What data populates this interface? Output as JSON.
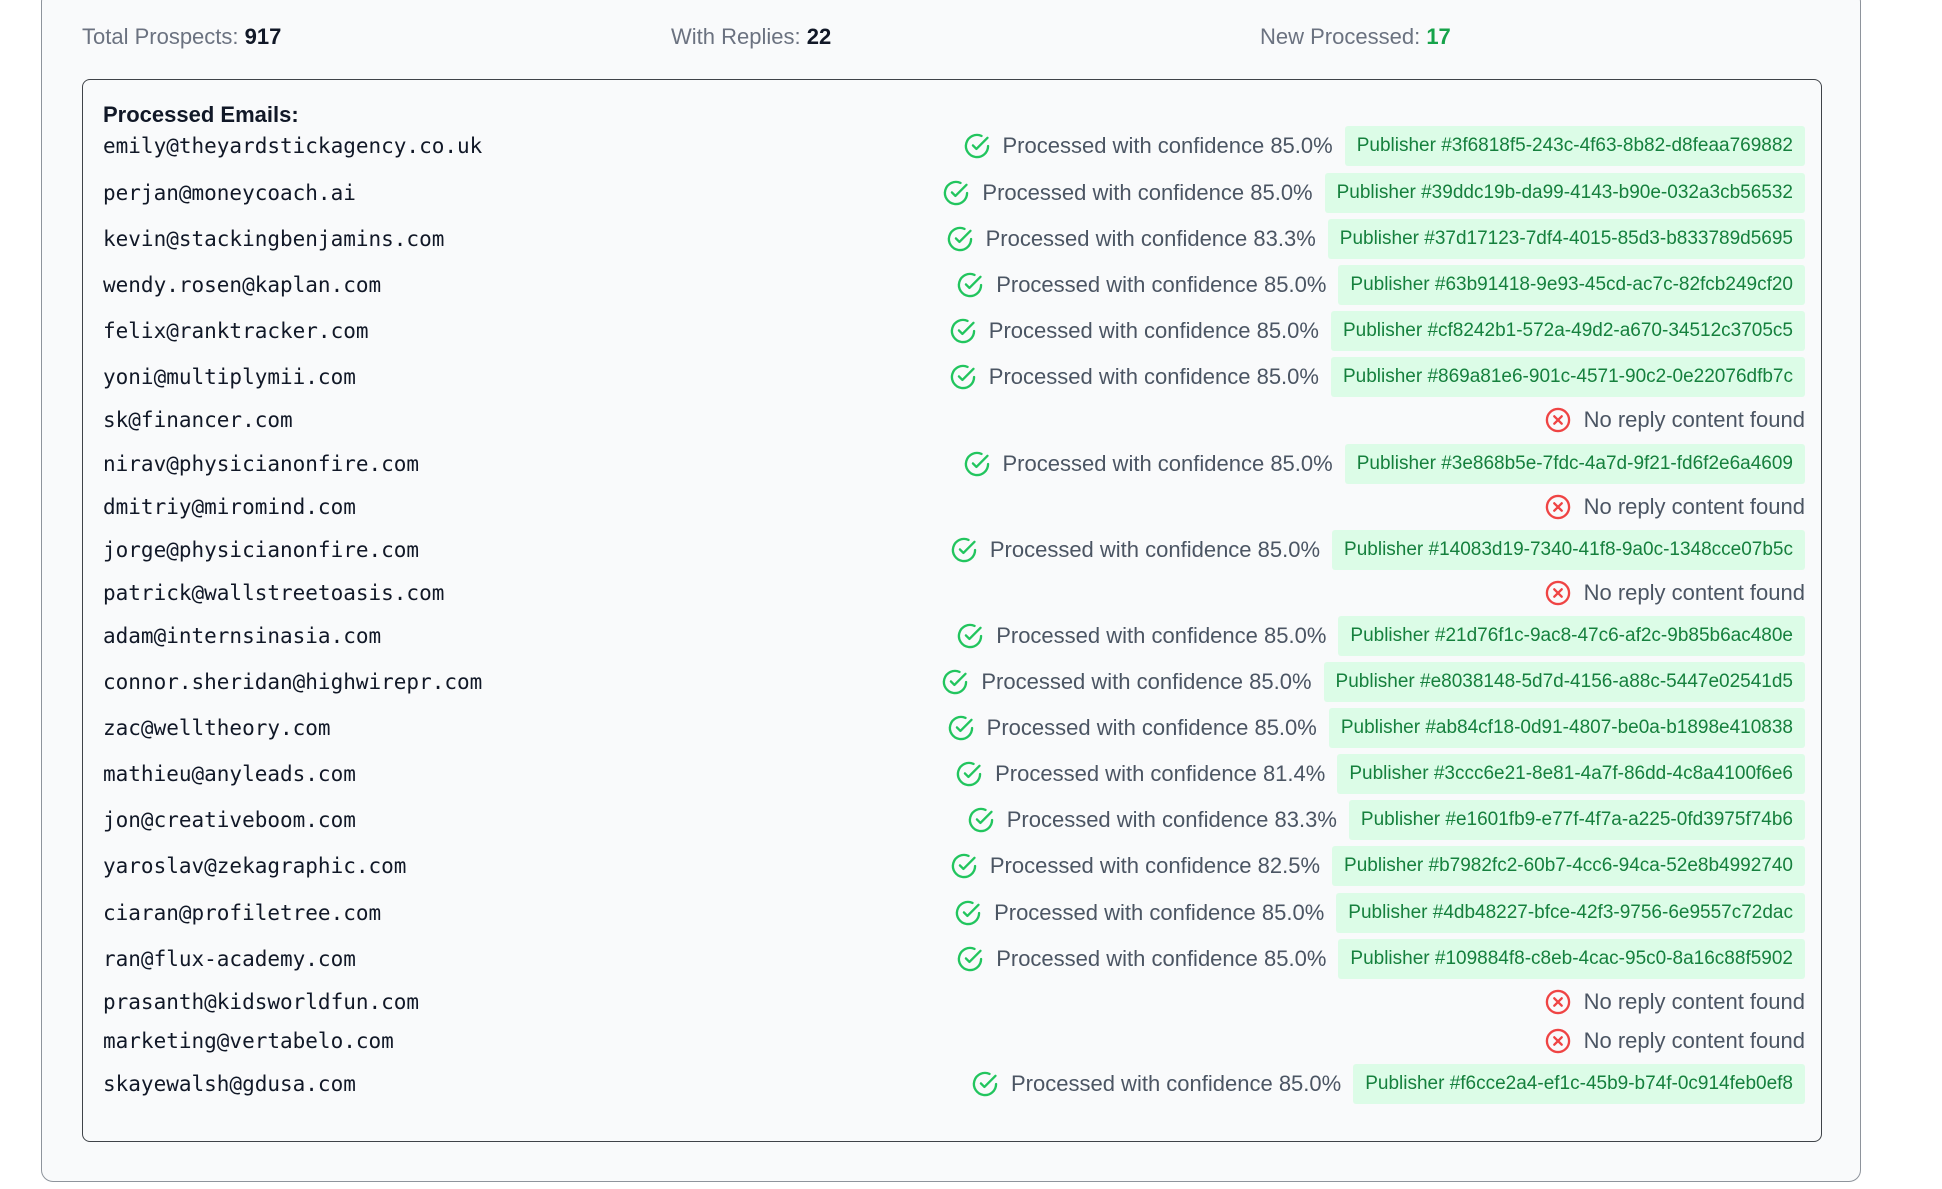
{
  "stats": {
    "total_label": "Total Prospects:",
    "total_value": "917",
    "replies_label": "With Replies:",
    "replies_value": "22",
    "new_label": "New Processed:",
    "new_value": "17"
  },
  "processed": {
    "title": "Processed Emails:",
    "rows": [
      {
        "email": "emily@theyardstickagency.co.uk",
        "status": "ok",
        "text": "Processed with confidence 85.0%",
        "publisher": "Publisher #3f6818f5-243c-4f63-8b82-d8feaa769882"
      },
      {
        "email": "perjan@moneycoach.ai",
        "status": "ok",
        "text": "Processed with confidence 85.0%",
        "publisher": "Publisher #39ddc19b-da99-4143-b90e-032a3cb56532"
      },
      {
        "email": "kevin@stackingbenjamins.com",
        "status": "ok",
        "text": "Processed with confidence 83.3%",
        "publisher": "Publisher #37d17123-7df4-4015-85d3-b833789d5695"
      },
      {
        "email": "wendy.rosen@kaplan.com",
        "status": "ok",
        "text": "Processed with confidence 85.0%",
        "publisher": "Publisher #63b91418-9e93-45cd-ac7c-82fcb249cf20"
      },
      {
        "email": "felix@ranktracker.com",
        "status": "ok",
        "text": "Processed with confidence 85.0%",
        "publisher": "Publisher #cf8242b1-572a-49d2-a670-34512c3705c5"
      },
      {
        "email": "yoni@multiplymii.com",
        "status": "ok",
        "text": "Processed with confidence 85.0%",
        "publisher": "Publisher #869a81e6-901c-4571-90c2-0e22076dfb7c"
      },
      {
        "email": "sk@financer.com",
        "status": "error",
        "text": "No reply content found",
        "publisher": ""
      },
      {
        "email": "nirav@physicianonfire.com",
        "status": "ok",
        "text": "Processed with confidence 85.0%",
        "publisher": "Publisher #3e868b5e-7fdc-4a7d-9f21-fd6f2e6a4609"
      },
      {
        "email": "dmitriy@miromind.com",
        "status": "error",
        "text": "No reply content found",
        "publisher": ""
      },
      {
        "email": "jorge@physicianonfire.com",
        "status": "ok",
        "text": "Processed with confidence 85.0%",
        "publisher": "Publisher #14083d19-7340-41f8-9a0c-1348cce07b5c"
      },
      {
        "email": "patrick@wallstreetoasis.com",
        "status": "error",
        "text": "No reply content found",
        "publisher": ""
      },
      {
        "email": "adam@internsinasia.com",
        "status": "ok",
        "text": "Processed with confidence 85.0%",
        "publisher": "Publisher #21d76f1c-9ac8-47c6-af2c-9b85b6ac480e"
      },
      {
        "email": "connor.sheridan@highwirepr.com",
        "status": "ok",
        "text": "Processed with confidence 85.0%",
        "publisher": "Publisher #e8038148-5d7d-4156-a88c-5447e02541d5"
      },
      {
        "email": "zac@welltheory.com",
        "status": "ok",
        "text": "Processed with confidence 85.0%",
        "publisher": "Publisher #ab84cf18-0d91-4807-be0a-b1898e410838"
      },
      {
        "email": "mathieu@anyleads.com",
        "status": "ok",
        "text": "Processed with confidence 81.4%",
        "publisher": "Publisher #3ccc6e21-8e81-4a7f-86dd-4c8a4100f6e6"
      },
      {
        "email": "jon@creativeboom.com",
        "status": "ok",
        "text": "Processed with confidence 83.3%",
        "publisher": "Publisher #e1601fb9-e77f-4f7a-a225-0fd3975f74b6"
      },
      {
        "email": "yaroslav@zekagraphic.com",
        "status": "ok",
        "text": "Processed with confidence 82.5%",
        "publisher": "Publisher #b7982fc2-60b7-4cc6-94ca-52e8b4992740"
      },
      {
        "email": "ciaran@profiletree.com",
        "status": "ok",
        "text": "Processed with confidence 85.0%",
        "publisher": "Publisher #4db48227-bfce-42f3-9756-6e9557c72dac"
      },
      {
        "email": "ran@flux-academy.com",
        "status": "ok",
        "text": "Processed with confidence 85.0%",
        "publisher": "Publisher #109884f8-c8eb-4cac-95c0-8a16c88f5902"
      },
      {
        "email": "prasanth@kidsworldfun.com",
        "status": "error",
        "text": "No reply content found",
        "publisher": ""
      },
      {
        "email": "marketing@vertabelo.com",
        "status": "error",
        "text": "No reply content found",
        "publisher": ""
      },
      {
        "email": "skayewalsh@gdusa.com",
        "status": "ok",
        "text": "Processed with confidence 85.0%",
        "publisher": "Publisher #f6cce2a4-ef1c-45b9-b74f-0c914feb0ef8"
      }
    ]
  },
  "icons": {
    "ok": "check-circle-icon",
    "error": "x-circle-icon"
  },
  "colors": {
    "ok": "#22c55e",
    "error": "#ef4444",
    "badge_bg": "#dcfce7",
    "badge_text": "#15803d",
    "new_processed": "#16a34a"
  }
}
